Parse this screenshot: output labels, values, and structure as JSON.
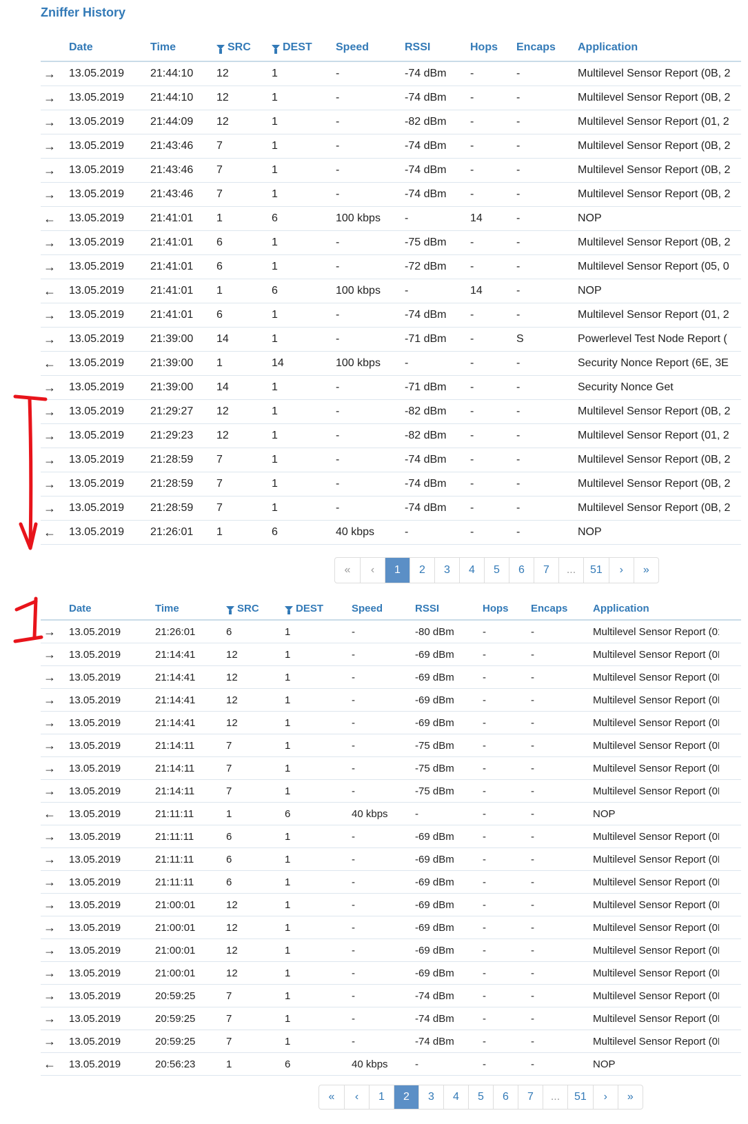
{
  "page_title": "Zniffer History",
  "columns": {
    "date": "Date",
    "time": "Time",
    "src": "SRC",
    "dest": "DEST",
    "speed": "Speed",
    "rssi": "RSSI",
    "hops": "Hops",
    "encaps": "Encaps",
    "application": "Application"
  },
  "filter_icon": "filter-icon",
  "page1_rows": [
    {
      "dir": "→",
      "date": "13.05.2019",
      "time": "21:44:10",
      "src": "12",
      "dest": "1",
      "speed": "-",
      "rssi": "-74 dBm",
      "hops": "-",
      "encaps": "-",
      "app": "Multilevel Sensor Report (0B, 2"
    },
    {
      "dir": "→",
      "date": "13.05.2019",
      "time": "21:44:10",
      "src": "12",
      "dest": "1",
      "speed": "-",
      "rssi": "-74 dBm",
      "hops": "-",
      "encaps": "-",
      "app": "Multilevel Sensor Report (0B, 2"
    },
    {
      "dir": "→",
      "date": "13.05.2019",
      "time": "21:44:09",
      "src": "12",
      "dest": "1",
      "speed": "-",
      "rssi": "-82 dBm",
      "hops": "-",
      "encaps": "-",
      "app": "Multilevel Sensor Report (01, 2"
    },
    {
      "dir": "→",
      "date": "13.05.2019",
      "time": "21:43:46",
      "src": "7",
      "dest": "1",
      "speed": "-",
      "rssi": "-74 dBm",
      "hops": "-",
      "encaps": "-",
      "app": "Multilevel Sensor Report (0B, 2"
    },
    {
      "dir": "→",
      "date": "13.05.2019",
      "time": "21:43:46",
      "src": "7",
      "dest": "1",
      "speed": "-",
      "rssi": "-74 dBm",
      "hops": "-",
      "encaps": "-",
      "app": "Multilevel Sensor Report (0B, 2"
    },
    {
      "dir": "→",
      "date": "13.05.2019",
      "time": "21:43:46",
      "src": "7",
      "dest": "1",
      "speed": "-",
      "rssi": "-74 dBm",
      "hops": "-",
      "encaps": "-",
      "app": "Multilevel Sensor Report (0B, 2"
    },
    {
      "dir": "←",
      "date": "13.05.2019",
      "time": "21:41:01",
      "src": "1",
      "dest": "6",
      "speed": "100 kbps",
      "rssi": "-",
      "hops": "14",
      "encaps": "-",
      "app": "NOP"
    },
    {
      "dir": "→",
      "date": "13.05.2019",
      "time": "21:41:01",
      "src": "6",
      "dest": "1",
      "speed": "-",
      "rssi": "-75 dBm",
      "hops": "-",
      "encaps": "-",
      "app": "Multilevel Sensor Report (0B, 2"
    },
    {
      "dir": "→",
      "date": "13.05.2019",
      "time": "21:41:01",
      "src": "6",
      "dest": "1",
      "speed": "-",
      "rssi": "-72 dBm",
      "hops": "-",
      "encaps": "-",
      "app": "Multilevel Sensor Report (05, 0"
    },
    {
      "dir": "←",
      "date": "13.05.2019",
      "time": "21:41:01",
      "src": "1",
      "dest": "6",
      "speed": "100 kbps",
      "rssi": "-",
      "hops": "14",
      "encaps": "-",
      "app": "NOP"
    },
    {
      "dir": "→",
      "date": "13.05.2019",
      "time": "21:41:01",
      "src": "6",
      "dest": "1",
      "speed": "-",
      "rssi": "-74 dBm",
      "hops": "-",
      "encaps": "-",
      "app": "Multilevel Sensor Report (01, 2"
    },
    {
      "dir": "→",
      "date": "13.05.2019",
      "time": "21:39:00",
      "src": "14",
      "dest": "1",
      "speed": "-",
      "rssi": "-71 dBm",
      "hops": "-",
      "encaps": "S",
      "app": "Powerlevel Test Node Report ("
    },
    {
      "dir": "←",
      "date": "13.05.2019",
      "time": "21:39:00",
      "src": "1",
      "dest": "14",
      "speed": "100 kbps",
      "rssi": "-",
      "hops": "-",
      "encaps": "-",
      "app": "Security Nonce Report (6E, 3E"
    },
    {
      "dir": "→",
      "date": "13.05.2019",
      "time": "21:39:00",
      "src": "14",
      "dest": "1",
      "speed": "-",
      "rssi": "-71 dBm",
      "hops": "-",
      "encaps": "-",
      "app": "Security Nonce Get"
    },
    {
      "dir": "→",
      "date": "13.05.2019",
      "time": "21:29:27",
      "src": "12",
      "dest": "1",
      "speed": "-",
      "rssi": "-82 dBm",
      "hops": "-",
      "encaps": "-",
      "app": "Multilevel Sensor Report (0B, 2"
    },
    {
      "dir": "→",
      "date": "13.05.2019",
      "time": "21:29:23",
      "src": "12",
      "dest": "1",
      "speed": "-",
      "rssi": "-82 dBm",
      "hops": "-",
      "encaps": "-",
      "app": "Multilevel Sensor Report (01, 2"
    },
    {
      "dir": "→",
      "date": "13.05.2019",
      "time": "21:28:59",
      "src": "7",
      "dest": "1",
      "speed": "-",
      "rssi": "-74 dBm",
      "hops": "-",
      "encaps": "-",
      "app": "Multilevel Sensor Report (0B, 2"
    },
    {
      "dir": "→",
      "date": "13.05.2019",
      "time": "21:28:59",
      "src": "7",
      "dest": "1",
      "speed": "-",
      "rssi": "-74 dBm",
      "hops": "-",
      "encaps": "-",
      "app": "Multilevel Sensor Report (0B, 2"
    },
    {
      "dir": "→",
      "date": "13.05.2019",
      "time": "21:28:59",
      "src": "7",
      "dest": "1",
      "speed": "-",
      "rssi": "-74 dBm",
      "hops": "-",
      "encaps": "-",
      "app": "Multilevel Sensor Report (0B, 2"
    },
    {
      "dir": "←",
      "date": "13.05.2019",
      "time": "21:26:01",
      "src": "1",
      "dest": "6",
      "speed": "40 kbps",
      "rssi": "-",
      "hops": "-",
      "encaps": "-",
      "app": "NOP"
    }
  ],
  "page2_rows": [
    {
      "dir": "→",
      "date": "13.05.2019",
      "time": "21:26:01",
      "src": "6",
      "dest": "1",
      "speed": "-",
      "rssi": "-80 dBm",
      "hops": "-",
      "encaps": "-",
      "app": "Multilevel Sensor Report (01"
    },
    {
      "dir": "→",
      "date": "13.05.2019",
      "time": "21:14:41",
      "src": "12",
      "dest": "1",
      "speed": "-",
      "rssi": "-69 dBm",
      "hops": "-",
      "encaps": "-",
      "app": "Multilevel Sensor Report (0B"
    },
    {
      "dir": "→",
      "date": "13.05.2019",
      "time": "21:14:41",
      "src": "12",
      "dest": "1",
      "speed": "-",
      "rssi": "-69 dBm",
      "hops": "-",
      "encaps": "-",
      "app": "Multilevel Sensor Report (0B"
    },
    {
      "dir": "→",
      "date": "13.05.2019",
      "time": "21:14:41",
      "src": "12",
      "dest": "1",
      "speed": "-",
      "rssi": "-69 dBm",
      "hops": "-",
      "encaps": "-",
      "app": "Multilevel Sensor Report (0B"
    },
    {
      "dir": "→",
      "date": "13.05.2019",
      "time": "21:14:41",
      "src": "12",
      "dest": "1",
      "speed": "-",
      "rssi": "-69 dBm",
      "hops": "-",
      "encaps": "-",
      "app": "Multilevel Sensor Report (0B"
    },
    {
      "dir": "→",
      "date": "13.05.2019",
      "time": "21:14:11",
      "src": "7",
      "dest": "1",
      "speed": "-",
      "rssi": "-75 dBm",
      "hops": "-",
      "encaps": "-",
      "app": "Multilevel Sensor Report (0B"
    },
    {
      "dir": "→",
      "date": "13.05.2019",
      "time": "21:14:11",
      "src": "7",
      "dest": "1",
      "speed": "-",
      "rssi": "-75 dBm",
      "hops": "-",
      "encaps": "-",
      "app": "Multilevel Sensor Report (0B"
    },
    {
      "dir": "→",
      "date": "13.05.2019",
      "time": "21:14:11",
      "src": "7",
      "dest": "1",
      "speed": "-",
      "rssi": "-75 dBm",
      "hops": "-",
      "encaps": "-",
      "app": "Multilevel Sensor Report (0B"
    },
    {
      "dir": "←",
      "date": "13.05.2019",
      "time": "21:11:11",
      "src": "1",
      "dest": "6",
      "speed": "40 kbps",
      "rssi": "-",
      "hops": "-",
      "encaps": "-",
      "app": "NOP"
    },
    {
      "dir": "→",
      "date": "13.05.2019",
      "time": "21:11:11",
      "src": "6",
      "dest": "1",
      "speed": "-",
      "rssi": "-69 dBm",
      "hops": "-",
      "encaps": "-",
      "app": "Multilevel Sensor Report (0B"
    },
    {
      "dir": "→",
      "date": "13.05.2019",
      "time": "21:11:11",
      "src": "6",
      "dest": "1",
      "speed": "-",
      "rssi": "-69 dBm",
      "hops": "-",
      "encaps": "-",
      "app": "Multilevel Sensor Report (0B"
    },
    {
      "dir": "→",
      "date": "13.05.2019",
      "time": "21:11:11",
      "src": "6",
      "dest": "1",
      "speed": "-",
      "rssi": "-69 dBm",
      "hops": "-",
      "encaps": "-",
      "app": "Multilevel Sensor Report (0B"
    },
    {
      "dir": "→",
      "date": "13.05.2019",
      "time": "21:00:01",
      "src": "12",
      "dest": "1",
      "speed": "-",
      "rssi": "-69 dBm",
      "hops": "-",
      "encaps": "-",
      "app": "Multilevel Sensor Report (0B"
    },
    {
      "dir": "→",
      "date": "13.05.2019",
      "time": "21:00:01",
      "src": "12",
      "dest": "1",
      "speed": "-",
      "rssi": "-69 dBm",
      "hops": "-",
      "encaps": "-",
      "app": "Multilevel Sensor Report (0B"
    },
    {
      "dir": "→",
      "date": "13.05.2019",
      "time": "21:00:01",
      "src": "12",
      "dest": "1",
      "speed": "-",
      "rssi": "-69 dBm",
      "hops": "-",
      "encaps": "-",
      "app": "Multilevel Sensor Report (0B"
    },
    {
      "dir": "→",
      "date": "13.05.2019",
      "time": "21:00:01",
      "src": "12",
      "dest": "1",
      "speed": "-",
      "rssi": "-69 dBm",
      "hops": "-",
      "encaps": "-",
      "app": "Multilevel Sensor Report (0B"
    },
    {
      "dir": "→",
      "date": "13.05.2019",
      "time": "20:59:25",
      "src": "7",
      "dest": "1",
      "speed": "-",
      "rssi": "-74 dBm",
      "hops": "-",
      "encaps": "-",
      "app": "Multilevel Sensor Report (0B"
    },
    {
      "dir": "→",
      "date": "13.05.2019",
      "time": "20:59:25",
      "src": "7",
      "dest": "1",
      "speed": "-",
      "rssi": "-74 dBm",
      "hops": "-",
      "encaps": "-",
      "app": "Multilevel Sensor Report (0B"
    },
    {
      "dir": "→",
      "date": "13.05.2019",
      "time": "20:59:25",
      "src": "7",
      "dest": "1",
      "speed": "-",
      "rssi": "-74 dBm",
      "hops": "-",
      "encaps": "-",
      "app": "Multilevel Sensor Report (0B"
    },
    {
      "dir": "←",
      "date": "13.05.2019",
      "time": "20:56:23",
      "src": "1",
      "dest": "6",
      "speed": "40 kbps",
      "rssi": "-",
      "hops": "-",
      "encaps": "-",
      "app": "NOP"
    }
  ],
  "pagination1": [
    {
      "label": "«",
      "state": "muted"
    },
    {
      "label": "‹",
      "state": "muted"
    },
    {
      "label": "1",
      "state": "active"
    },
    {
      "label": "2",
      "state": ""
    },
    {
      "label": "3",
      "state": ""
    },
    {
      "label": "4",
      "state": ""
    },
    {
      "label": "5",
      "state": ""
    },
    {
      "label": "6",
      "state": ""
    },
    {
      "label": "7",
      "state": ""
    },
    {
      "label": "...",
      "state": "muted"
    },
    {
      "label": "51",
      "state": ""
    },
    {
      "label": "›",
      "state": ""
    },
    {
      "label": "»",
      "state": ""
    }
  ],
  "pagination2": [
    {
      "label": "«",
      "state": ""
    },
    {
      "label": "‹",
      "state": ""
    },
    {
      "label": "1",
      "state": ""
    },
    {
      "label": "2",
      "state": "active"
    },
    {
      "label": "3",
      "state": ""
    },
    {
      "label": "4",
      "state": ""
    },
    {
      "label": "5",
      "state": ""
    },
    {
      "label": "6",
      "state": ""
    },
    {
      "label": "7",
      "state": ""
    },
    {
      "label": "...",
      "state": "muted"
    },
    {
      "label": "51",
      "state": ""
    },
    {
      "label": "›",
      "state": ""
    },
    {
      "label": "»",
      "state": ""
    }
  ],
  "annotation_color": "#e8141b"
}
